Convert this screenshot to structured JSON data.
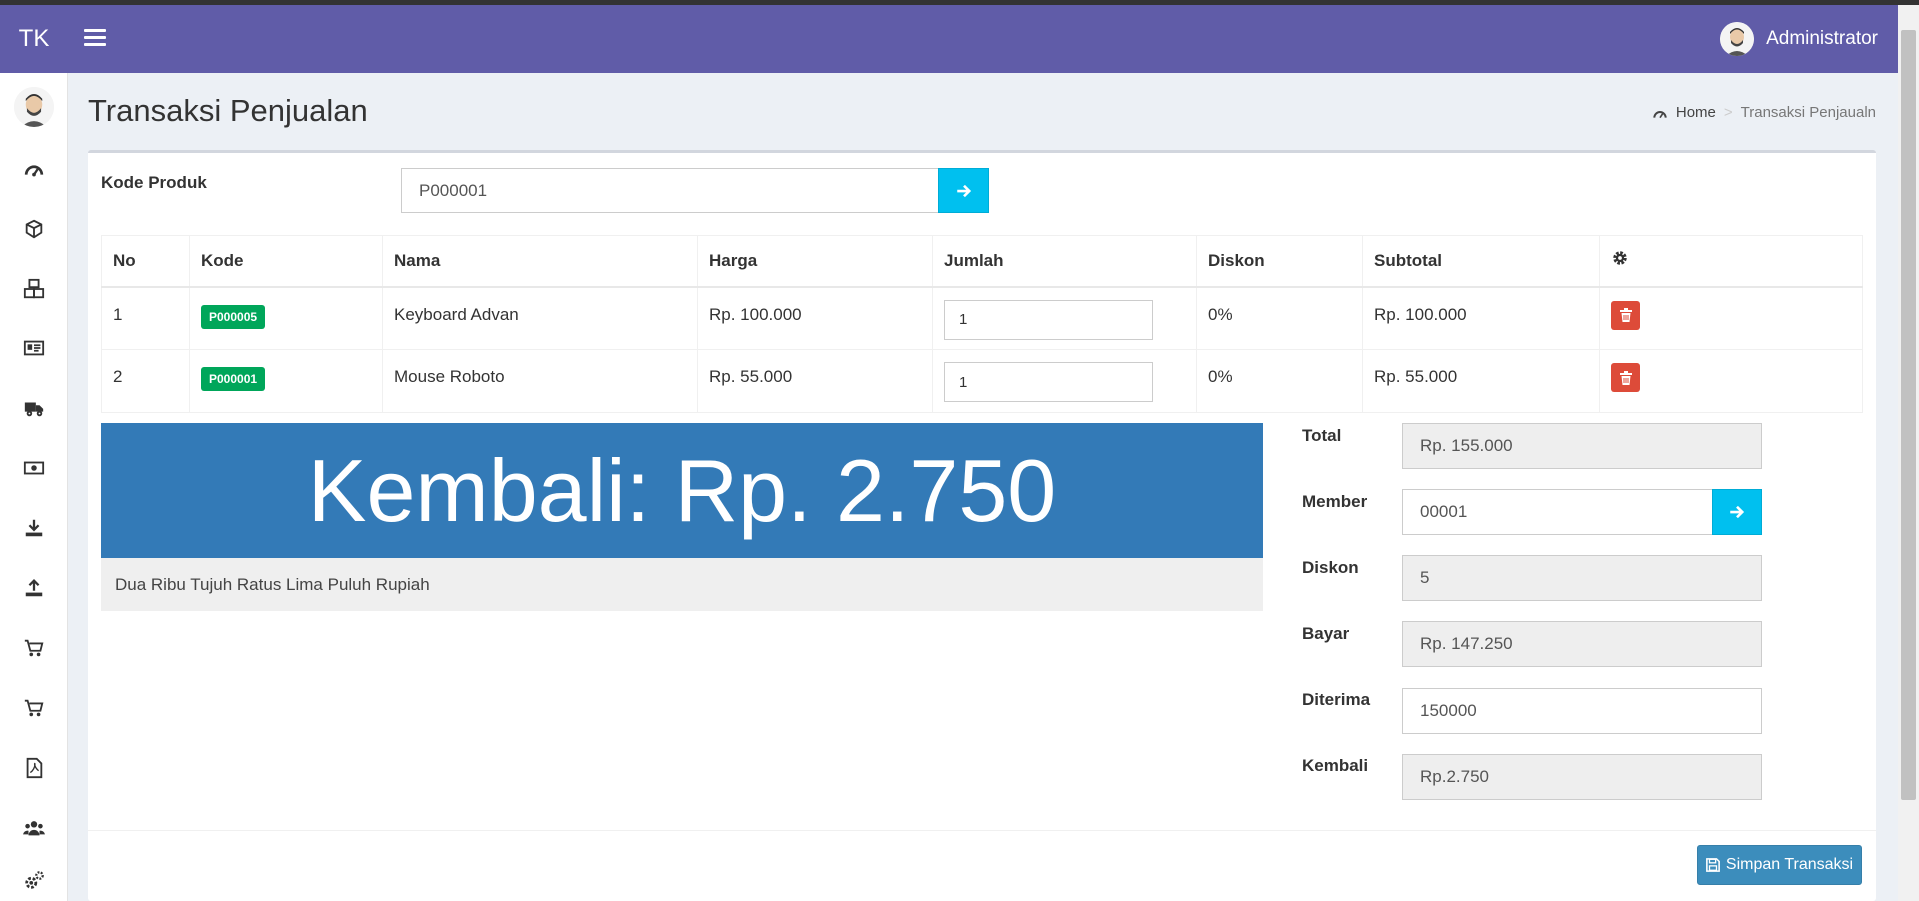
{
  "app": {
    "brand": "TK"
  },
  "user": {
    "name": "Administrator"
  },
  "page": {
    "title": "Transaksi Penjualan"
  },
  "breadcrumb": {
    "home": "Home",
    "separator": ">",
    "current": "Transaksi Penjaualn"
  },
  "sidebar": {
    "icons": [
      "dashboard-icon",
      "box-icon",
      "boxes-icon",
      "id-card-icon",
      "truck-icon",
      "money-icon",
      "download-icon",
      "upload-icon",
      "cart-icon",
      "cart-icon",
      "pdf-icon",
      "users-icon",
      "settings-icon"
    ]
  },
  "product_code": {
    "label": "Kode Produk",
    "value": "P000001"
  },
  "table": {
    "headers": {
      "no": "No",
      "kode": "Kode",
      "nama": "Nama",
      "harga": "Harga",
      "jumlah": "Jumlah",
      "diskon": "Diskon",
      "subtotal": "Subtotal"
    },
    "rows": [
      {
        "no": "1",
        "kode": "P000005",
        "nama": "Keyboard Advan",
        "harga": "Rp. 100.000",
        "jumlah": "1",
        "diskon": "0%",
        "subtotal": "Rp. 100.000"
      },
      {
        "no": "2",
        "kode": "P000001",
        "nama": "Mouse Roboto",
        "harga": "Rp. 55.000",
        "jumlah": "1",
        "diskon": "0%",
        "subtotal": "Rp. 55.000"
      }
    ]
  },
  "summary": {
    "kembali_display": "Kembali: Rp. 2.750",
    "terbilang": "Dua Ribu Tujuh Ratus Lima Puluh Rupiah"
  },
  "form": {
    "total": {
      "label": "Total",
      "value": "Rp. 155.000"
    },
    "member": {
      "label": "Member",
      "value": "00001"
    },
    "diskon": {
      "label": "Diskon",
      "value": "5"
    },
    "bayar": {
      "label": "Bayar",
      "value": "Rp. 147.250"
    },
    "diterima": {
      "label": "Diterima",
      "value": "150000"
    },
    "kembali": {
      "label": "Kembali",
      "value": "Rp.2.750"
    }
  },
  "actions": {
    "save_label": "Simpan Transaksi"
  },
  "colors": {
    "navbar": "#605ca8",
    "accent": "#00c0ef",
    "primary": "#3c8dbc",
    "success": "#00a65a",
    "danger": "#dd4b39",
    "panel": "#337ab7"
  }
}
